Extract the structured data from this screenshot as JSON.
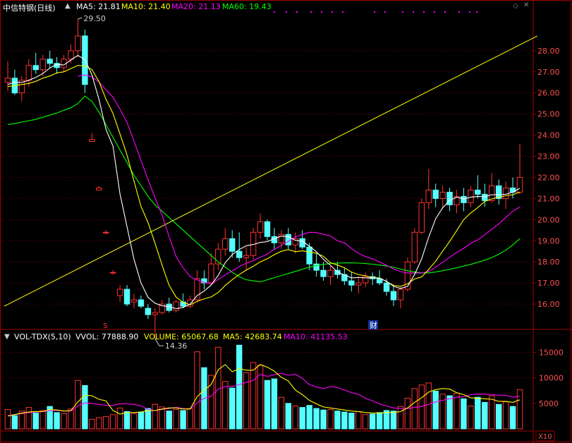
{
  "header": {
    "stock": "中信特钢(日线)",
    "ma": [
      {
        "label": "MA5: 21.81",
        "color": "#ffffff"
      },
      {
        "label": "MA10: 21.40",
        "color": "#ffff00"
      },
      {
        "label": "MA20: 21.13",
        "color": "#ff00ff"
      },
      {
        "label": "MA60: 19.43",
        "color": "#00ff00"
      }
    ]
  },
  "volume_header": {
    "indicator": "VOL-TDX(5,10)",
    "vvol": "VVOL: 77888.90",
    "volume": "VOLUME: 65067.68",
    "ma5": "MA5: 42683.74",
    "ma10": "MA10: 41135.53"
  },
  "annotations": {
    "high_label": "29.50",
    "low_label": "14.36",
    "marker_s": "S",
    "marker_cai": "财",
    "x10": "X10"
  },
  "colors": {
    "up": "#ff3232",
    "down": "#54ffff",
    "ma5": "#ffffff",
    "ma10": "#ffff00",
    "ma20": "#ff00ff",
    "ma60": "#00ff00",
    "trendline": "#ffff00",
    "grid": "#7a0000",
    "axis": "#a00000"
  },
  "chart_data": [
    {
      "type": "candlestick",
      "title": "中信特钢(日线)",
      "y_ticks": [
        16,
        17,
        18,
        19,
        20,
        21,
        22,
        23,
        24,
        25,
        26,
        27,
        28
      ],
      "ylim": [
        15.2,
        29.8
      ],
      "grid": true,
      "candles": [
        [
          26.5,
          27.5,
          26.1,
          26.7
        ],
        [
          26.7,
          27.1,
          25.9,
          26.0
        ],
        [
          26.0,
          26.8,
          25.6,
          26.6
        ],
        [
          26.6,
          27.6,
          26.3,
          27.3
        ],
        [
          27.3,
          27.9,
          26.9,
          27.1
        ],
        [
          27.1,
          27.8,
          26.8,
          27.6
        ],
        [
          27.6,
          28.0,
          27.2,
          27.4
        ],
        [
          27.4,
          27.7,
          26.9,
          27.2
        ],
        [
          27.2,
          27.8,
          27.0,
          27.6
        ],
        [
          27.6,
          28.3,
          27.4,
          28.0
        ],
        [
          28.0,
          29.5,
          27.7,
          28.7
        ],
        [
          28.7,
          29.0,
          26.0,
          26.4
        ],
        [
          23.7,
          24.1,
          23.7,
          23.8
        ],
        [
          21.4,
          21.6,
          21.4,
          21.5
        ],
        [
          19.4,
          19.5,
          19.3,
          19.4
        ],
        [
          17.5,
          17.6,
          17.4,
          17.5
        ],
        [
          16.4,
          16.9,
          16.1,
          16.7
        ],
        [
          16.7,
          16.9,
          15.9,
          16.0
        ],
        [
          16.1,
          16.5,
          15.8,
          16.2
        ],
        [
          16.2,
          16.4,
          15.8,
          15.9
        ],
        [
          15.8,
          16.0,
          15.3,
          15.5
        ],
        [
          15.5,
          15.8,
          14.36,
          15.6
        ],
        [
          15.6,
          16.2,
          15.5,
          16.0
        ],
        [
          16.0,
          16.3,
          15.6,
          15.7
        ],
        [
          15.7,
          16.2,
          15.6,
          16.1
        ],
        [
          16.1,
          16.5,
          15.8,
          15.9
        ],
        [
          15.9,
          16.4,
          15.8,
          16.2
        ],
        [
          16.2,
          17.6,
          16.1,
          17.2
        ],
        [
          17.2,
          17.6,
          16.7,
          17.0
        ],
        [
          17.0,
          18.4,
          16.9,
          17.9
        ],
        [
          17.9,
          18.9,
          17.6,
          18.6
        ],
        [
          18.6,
          19.6,
          18.3,
          19.1
        ],
        [
          19.1,
          19.5,
          18.2,
          18.5
        ],
        [
          18.5,
          19.4,
          18.0,
          18.2
        ],
        [
          18.2,
          18.7,
          17.6,
          18.3
        ],
        [
          18.3,
          19.6,
          18.1,
          19.4
        ],
        [
          19.4,
          20.3,
          19.1,
          19.9
        ],
        [
          19.9,
          20.0,
          19.0,
          19.2
        ],
        [
          19.2,
          19.6,
          18.6,
          18.9
        ],
        [
          18.9,
          19.5,
          18.6,
          19.3
        ],
        [
          19.3,
          19.6,
          18.6,
          18.8
        ],
        [
          18.8,
          19.4,
          18.4,
          19.1
        ],
        [
          19.1,
          19.5,
          18.6,
          18.7
        ],
        [
          18.7,
          18.9,
          17.6,
          17.9
        ],
        [
          17.9,
          18.4,
          17.3,
          17.6
        ],
        [
          17.6,
          18.0,
          17.1,
          17.3
        ],
        [
          17.3,
          17.8,
          16.9,
          17.6
        ],
        [
          17.6,
          18.0,
          17.2,
          17.4
        ],
        [
          17.4,
          17.7,
          16.9,
          17.1
        ],
        [
          17.1,
          17.5,
          16.6,
          16.9
        ],
        [
          16.9,
          17.3,
          16.5,
          17.0
        ],
        [
          17.0,
          17.5,
          16.8,
          17.3
        ],
        [
          17.3,
          17.5,
          16.9,
          17.2
        ],
        [
          17.2,
          17.6,
          16.9,
          17.0
        ],
        [
          17.0,
          17.2,
          16.4,
          16.6
        ],
        [
          16.6,
          16.9,
          15.9,
          16.2
        ],
        [
          16.2,
          16.8,
          15.8,
          16.7
        ],
        [
          16.7,
          18.2,
          16.6,
          18.0
        ],
        [
          18.0,
          19.6,
          17.9,
          19.4
        ],
        [
          19.4,
          21.0,
          19.3,
          20.8
        ],
        [
          20.8,
          22.4,
          20.5,
          21.4
        ],
        [
          21.4,
          21.7,
          20.6,
          21.0
        ],
        [
          21.0,
          21.6,
          20.5,
          21.3
        ],
        [
          21.3,
          21.5,
          20.4,
          20.7
        ],
        [
          20.7,
          21.4,
          20.3,
          21.1
        ],
        [
          21.1,
          21.5,
          20.4,
          20.8
        ],
        [
          20.8,
          21.6,
          20.6,
          21.4
        ],
        [
          21.4,
          22.1,
          21.0,
          21.2
        ],
        [
          21.2,
          21.7,
          20.6,
          20.9
        ],
        [
          20.9,
          22.2,
          20.8,
          21.6
        ],
        [
          21.6,
          21.9,
          20.7,
          21.0
        ],
        [
          21.0,
          21.8,
          20.5,
          21.5
        ],
        [
          21.5,
          22.0,
          21.0,
          21.3
        ],
        [
          21.3,
          23.6,
          21.2,
          22.0
        ]
      ],
      "ma": {
        "MA5": [
          26.4,
          26.5,
          26.5,
          26.6,
          26.74,
          26.92,
          27.18,
          27.36,
          27.32,
          27.56,
          27.78,
          27.58,
          26.86,
          25.7,
          24.28,
          23.48,
          21.22,
          19.66,
          18.12,
          17.0,
          16.32,
          16.04,
          15.92,
          15.88,
          15.78,
          15.84,
          16.0,
          16.4,
          16.62,
          16.9,
          17.36,
          17.96,
          18.34,
          18.58,
          18.76,
          18.82,
          18.92,
          18.96,
          19.1,
          19.22,
          19.2,
          19.02,
          18.98,
          18.74,
          18.48,
          18.12,
          17.84,
          17.52,
          17.38,
          17.24,
          17.26,
          17.24,
          17.24,
          17.22,
          17.08,
          16.84,
          16.74,
          16.84,
          17.4,
          18.14,
          19.16,
          20.04,
          20.56,
          20.92,
          21.06,
          20.98,
          21.06,
          21.1,
          21.08,
          21.18,
          21.18,
          21.2,
          21.3,
          21.48
        ],
        "MA10": [
          26.3,
          26.35,
          26.4,
          26.45,
          26.55,
          26.7,
          26.8,
          26.95,
          27.0,
          27.15,
          27.3,
          27.28,
          27.11,
          26.54,
          25.71,
          25.03,
          24.06,
          23.06,
          21.82,
          20.63,
          19.86,
          18.88,
          17.85,
          16.89,
          16.33,
          16.08,
          15.97,
          16.13,
          16.25,
          16.34,
          16.55,
          16.88,
          17.15,
          17.4,
          17.61,
          17.79,
          18.0,
          18.15,
          18.34,
          18.5,
          18.58,
          18.48,
          18.52,
          18.47,
          18.41,
          18.26,
          17.96,
          17.85,
          17.72,
          17.52,
          17.39,
          17.34,
          17.25,
          17.24,
          17.06,
          16.89,
          16.84,
          16.96,
          17.19,
          17.28,
          17.64,
          18.03,
          18.5,
          18.97,
          19.48,
          20.0,
          20.32,
          20.57,
          20.86,
          20.98,
          21.06,
          21.13,
          21.18,
          21.3
        ],
        "MA20": [
          null,
          null,
          null,
          null,
          null,
          null,
          null,
          null,
          null,
          null,
          26.8,
          26.85,
          26.76,
          26.52,
          26.15,
          25.8,
          25.24,
          24.6,
          23.72,
          22.8,
          21.9,
          21.03,
          20.21,
          19.2,
          18.25,
          17.72,
          17.3,
          17.14,
          17.02,
          16.97,
          17.16,
          17.38,
          17.57,
          17.78,
          17.93,
          18.06,
          18.22,
          18.37,
          18.59,
          18.78,
          18.97,
          19.18,
          19.3,
          19.4,
          19.39,
          19.31,
          19.23,
          19.0,
          18.9,
          18.63,
          18.4,
          18.25,
          18.14,
          18.0,
          17.83,
          17.67,
          17.54,
          17.47,
          17.47,
          17.47,
          17.55,
          17.75,
          17.98,
          18.22,
          18.45,
          18.64,
          18.88,
          19.04,
          19.28,
          19.54,
          19.8,
          20.1,
          20.4,
          20.6
        ],
        "MA60": [
          24.5,
          24.55,
          24.62,
          24.68,
          24.75,
          24.85,
          24.95,
          25.05,
          25.18,
          25.3,
          25.5,
          25.85,
          25.6,
          25.1,
          24.5,
          23.9,
          23.3,
          22.7,
          22.1,
          21.6,
          21.1,
          20.7,
          20.4,
          20.1,
          19.8,
          19.5,
          19.2,
          18.9,
          18.6,
          18.3,
          18.0,
          17.75,
          17.5,
          17.3,
          17.15,
          17.1,
          17.05,
          17.15,
          17.25,
          17.35,
          17.45,
          17.55,
          17.65,
          17.75,
          17.82,
          17.88,
          17.92,
          17.94,
          17.95,
          17.95,
          17.94,
          17.92,
          17.89,
          17.85,
          17.8,
          17.74,
          17.66,
          17.58,
          17.52,
          17.48,
          17.48,
          17.52,
          17.58,
          17.65,
          17.72,
          17.8,
          17.88,
          17.98,
          18.08,
          18.2,
          18.36,
          18.55,
          18.8,
          19.1
        ]
      },
      "trendline": [
        [
          0,
          15.9
        ],
        [
          75,
          28.7
        ]
      ]
    },
    {
      "type": "bar",
      "title": "VOL-TDX(5,10)",
      "y_ticks": [
        5000,
        10000,
        15000
      ],
      "ylim": [
        0,
        17000
      ],
      "volumes": [
        3800,
        2600,
        3500,
        4200,
        3100,
        3600,
        4400,
        3200,
        3000,
        3900,
        9500,
        8500,
        1900,
        2200,
        2400,
        2800,
        4100,
        3400,
        3000,
        3300,
        4000,
        4800,
        4300,
        3500,
        3800,
        3600,
        4000,
        15100,
        12000,
        10500,
        16000,
        9300,
        8000,
        16400,
        11000,
        13000,
        12500,
        9500,
        9800,
        6200,
        5000,
        4500,
        4200,
        4600,
        4000,
        3700,
        3800,
        3500,
        3300,
        3100,
        3400,
        2800,
        2900,
        3200,
        3600,
        3500,
        4400,
        6000,
        7900,
        8600,
        9000,
        7400,
        6800,
        6500,
        7000,
        5900,
        4500,
        6200,
        5200,
        6500,
        4800,
        5300,
        4400,
        7700
      ],
      "ma5": [
        2500,
        2800,
        3100,
        3300,
        3400,
        3400,
        3800,
        3700,
        3500,
        3600,
        5300,
        6600,
        6500,
        5800,
        5500,
        3600,
        2900,
        3200,
        3200,
        3300,
        3600,
        3600,
        3900,
        4100,
        4100,
        3900,
        3900,
        6300,
        7600,
        8700,
        11600,
        12600,
        11200,
        11800,
        11500,
        11500,
        12600,
        12100,
        11300,
        10100,
        9400,
        7600,
        6700,
        5600,
        4900,
        4300,
        4100,
        3900,
        3700,
        3500,
        3400,
        3200,
        3100,
        3100,
        3200,
        3200,
        3400,
        4100,
        5200,
        6100,
        7200,
        7700,
        7900,
        7800,
        7100,
        6700,
        6100,
        6000,
        5900,
        5800,
        5400,
        5400,
        5200,
        5700
      ],
      "ma10": [
        2600,
        2800,
        3000,
        3200,
        3300,
        3400,
        3600,
        3600,
        3500,
        3500,
        4500,
        5100,
        5000,
        4800,
        4600,
        4600,
        4900,
        4900,
        4800,
        4500,
        3800,
        3600,
        3800,
        4000,
        4200,
        4000,
        3900,
        5100,
        6000,
        6400,
        7800,
        8300,
        8300,
        8700,
        9100,
        9500,
        10700,
        10300,
        10600,
        10900,
        10500,
        10700,
        9900,
        8700,
        8200,
        7900,
        8300,
        8100,
        7600,
        7100,
        6800,
        6000,
        5500,
        4900,
        4500,
        4100,
        4000,
        4000,
        4200,
        4400,
        4800,
        5300,
        5600,
        5900,
        6200,
        6300,
        6700,
        6800,
        6800,
        6700,
        6600,
        6600,
        6200,
        6400
      ]
    }
  ]
}
